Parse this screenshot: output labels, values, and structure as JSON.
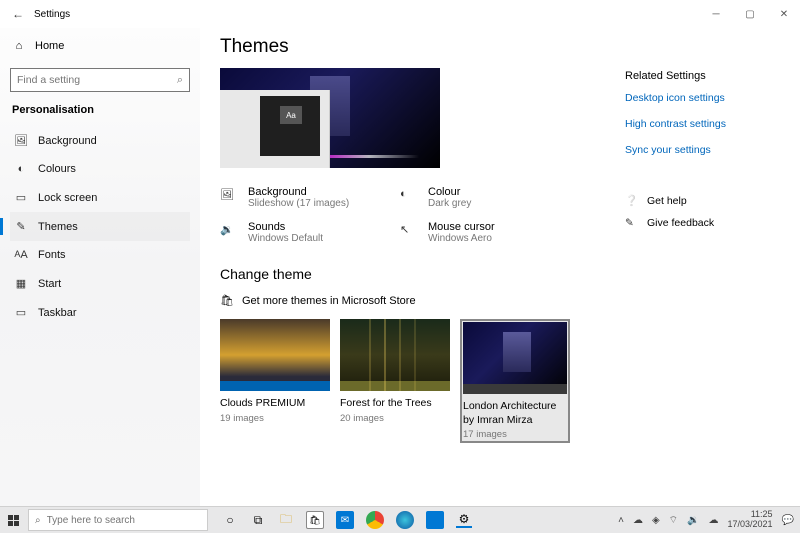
{
  "window": {
    "title": "Settings"
  },
  "sidebar": {
    "home": "Home",
    "search_placeholder": "Find a setting",
    "header": "Personalisation",
    "items": [
      {
        "label": "Background"
      },
      {
        "label": "Colours"
      },
      {
        "label": "Lock screen"
      },
      {
        "label": "Themes",
        "active": true
      },
      {
        "label": "Fonts"
      },
      {
        "label": "Start"
      },
      {
        "label": "Taskbar"
      }
    ]
  },
  "main": {
    "title": "Themes",
    "preview_aa": "Aa",
    "settings": {
      "background": {
        "label": "Background",
        "value": "Slideshow (17 images)"
      },
      "colour": {
        "label": "Colour",
        "value": "Dark grey"
      },
      "sounds": {
        "label": "Sounds",
        "value": "Windows Default"
      },
      "cursor": {
        "label": "Mouse cursor",
        "value": "Windows Aero"
      }
    },
    "change_header": "Change theme",
    "store_link": "Get more themes in Microsoft Store",
    "themes": [
      {
        "name": "Clouds PREMIUM",
        "count": "19 images",
        "bar": "#0063b1"
      },
      {
        "name": "Forest for the Trees",
        "count": "20 images",
        "bar": "#6b6a2a"
      },
      {
        "name": "London Architecture by Imran Mirza",
        "count": "17 images",
        "bar": "#3a3a3a",
        "selected": true
      }
    ]
  },
  "right": {
    "header": "Related Settings",
    "links": [
      "Desktop icon settings",
      "High contrast settings",
      "Sync your settings"
    ],
    "help": "Get help",
    "feedback": "Give feedback"
  },
  "taskbar": {
    "search_placeholder": "Type here to search",
    "time": "11:25",
    "date": "17/03/2021"
  }
}
